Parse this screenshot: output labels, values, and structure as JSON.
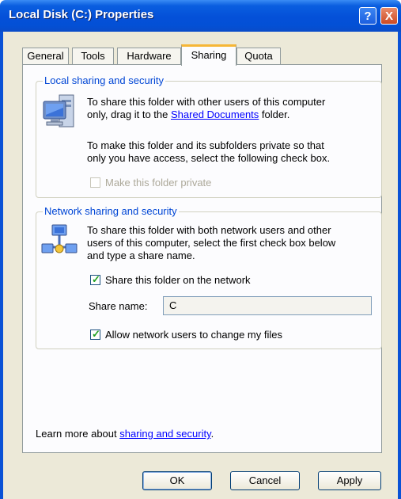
{
  "window": {
    "title": "Local Disk (C:) Properties",
    "help_glyph": "?",
    "close_glyph": "X"
  },
  "tabs": [
    {
      "label": "General"
    },
    {
      "label": "Tools"
    },
    {
      "label": "Hardware"
    },
    {
      "label": "Sharing",
      "active": true
    },
    {
      "label": "Quota"
    }
  ],
  "local_sharing": {
    "title": "Local sharing and security",
    "line1": "To share this folder with other users of this computer",
    "line2_prefix": "only, drag it to the",
    "link": "Shared Documents",
    "line2_suffix": "folder.",
    "private_line1": "To make this folder and its subfolders private so that",
    "private_line2": "only you have access, select the following check box.",
    "checkbox_label": "Make this folder private",
    "checkbox_checked": false,
    "checkbox_enabled": false
  },
  "network_sharing": {
    "title": "Network sharing and security",
    "line1": "To share this folder with both network users and other",
    "line2": "users of this computer, select the first check box below",
    "line3": "and type a share name.",
    "share_checkbox_label": "Share this folder on the network",
    "share_checked": true,
    "share_name_label": "Share name:",
    "share_name_value": "C",
    "allow_checkbox_label": "Allow network users to change my files",
    "allow_checked": true
  },
  "footer": {
    "learn_more_prefix": "Learn more about",
    "learn_more_link": "sharing and security",
    "learn_more_suffix": "."
  },
  "buttons": {
    "ok": "OK",
    "cancel": "Cancel",
    "apply": "Apply"
  },
  "colors": {
    "title_bar": "#0450d8",
    "group_title": "#0046d5",
    "link": "#0000ff",
    "active_tab_accent": "#f6b636"
  }
}
